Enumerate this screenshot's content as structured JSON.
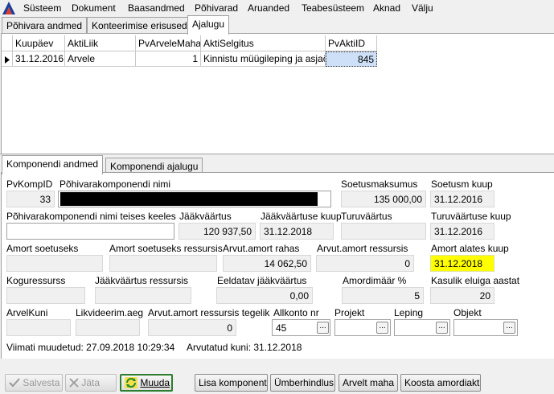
{
  "menu": [
    "Süsteem",
    "Dokument",
    "Baasandmed",
    "Põhivarad",
    "Aruanded",
    "Teabesüsteem",
    "Aknad",
    "Välju"
  ],
  "top_tabs": [
    "Põhivara andmed",
    "Konteerimise erisused",
    "Ajalugu"
  ],
  "history_grid": {
    "columns": [
      "Kuupäev",
      "AktiLiik",
      "PvArveleMaha",
      "AktiSelgitus",
      "PvAktiID"
    ],
    "rows": [
      [
        "31.12.2016",
        "Arvele",
        "1",
        "Kinnistu müügileping ja asjaõ",
        "845"
      ]
    ]
  },
  "bottom_tabs": [
    "Komponendi andmed",
    "Komponendi ajalugu"
  ],
  "form": {
    "pvkompid_label": "PvKompID",
    "pvkompid": "33",
    "komp_nimi_label": "Põhivarakomponendi nimi",
    "komp_nimi": "",
    "soetusmaksumus_label": "Soetusmaksumus",
    "soetusmaksumus": "135 000,00",
    "soetusm_kuup_label": "Soetusm kuup",
    "soetusm_kuup": "31.12.2016",
    "komp_nimi_teises_label": "Põhivarakomponendi nimi teises keeles",
    "komp_nimi_teises": "",
    "jaakvaartus_label": "Jääkväärtus",
    "jaakvaartus": "120 937,50",
    "jaakvaartuse_kuup_label": "Jääkväärtuse kuup",
    "jaakvaartuse_kuup": "31.12.2018",
    "turuvaartus_label": "Turuväärtus",
    "turuvaartus": "",
    "turuvaartuse_kuup_label": "Turuväärtuse kuup",
    "turuvaartuse_kuup": "31.12.2016",
    "amort_soetuseks_label": "Amort soetuseks",
    "amort_soetuseks": "",
    "amort_soet_ressursis_label": "Amort soetuseks ressursis",
    "amort_soet_ressursis": "",
    "arvut_amort_rahas_label": "Arvut.amort rahas",
    "arvut_amort_rahas": "14 062,50",
    "arvut_amort_ressursis_label": "Arvut.amort ressursis",
    "arvut_amort_ressursis": "0",
    "amort_alates_kuup_label": "Amort alates kuup",
    "amort_alates_kuup": "31.12.2018",
    "koguressurss_label": "Koguressurss",
    "koguressurss": "",
    "jaakvaartus_ressursis_label": "Jääkväärtus ressursis",
    "jaakvaartus_ressursis": "",
    "eeldatav_jaakvaartus_label": "Eeldatav jääkväärtus",
    "eeldatav_jaakvaartus": "0,00",
    "amordimaar_label": "Amordimäär %",
    "amordimaar": "5",
    "kasulik_eluiga_label": "Kasulik eluiga aastat",
    "kasulik_eluiga": "20",
    "arvelkuni_label": "ArvelKuni",
    "arvelkuni": "",
    "likvideerim_aeg_label": "Likvideerim.aeg",
    "likvideerim_aeg": "",
    "arvut_amort_tegelik_label": "Arvut.amort ressursis tegelik",
    "arvut_amort_tegelik": "0",
    "allkonto_nr_label": "Allkonto nr",
    "allkonto_nr": "45",
    "projekt_label": "Projekt",
    "projekt": "",
    "leping_label": "Leping",
    "leping": "",
    "objekt_label": "Objekt",
    "objekt": "",
    "ellipsis": "...",
    "viimati_muudetud": "Viimati muudetud: 27.09.2018 10:29:34",
    "arvutatud_kuni": "Arvutatud kuni: 31.12.2018"
  },
  "buttons": {
    "salvesta": "Salvesta",
    "jata": "Jäta",
    "muuda": "Muuda",
    "lisa_komponent": "Lisa komponent",
    "umberhindlus": "Ümberhindlus",
    "arvelt_maha": "Arvelt maha",
    "koosta_amordiakt": "Koosta amordiakt"
  },
  "colors": {
    "highlight": "#ffff00",
    "selected_cell": "#cde0f7",
    "redacted": "#000000"
  }
}
